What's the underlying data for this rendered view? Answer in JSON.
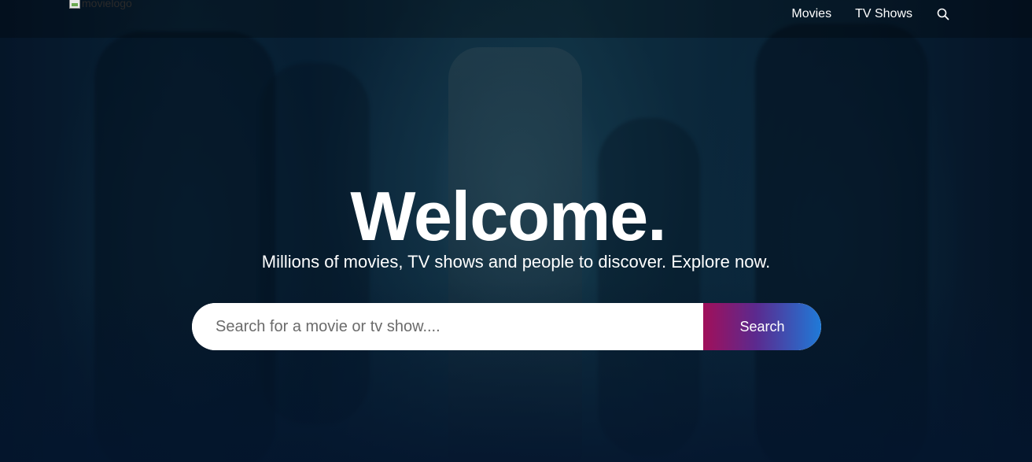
{
  "header": {
    "logo_alt": "movielogo",
    "nav": [
      {
        "label": "Movies"
      },
      {
        "label": "TV Shows"
      }
    ],
    "search_icon": "search-icon"
  },
  "hero": {
    "title": "Welcome.",
    "subtitle": "Millions of movies, TV shows and people to discover. Explore now.",
    "search": {
      "placeholder": "Search for a movie or tv show....",
      "value": "",
      "button_label": "Search"
    }
  },
  "colors": {
    "page_background": "#04152d",
    "button_gradient_start": "#a10f5a",
    "button_gradient_end": "#1f7ad8",
    "text": "#ffffff"
  }
}
